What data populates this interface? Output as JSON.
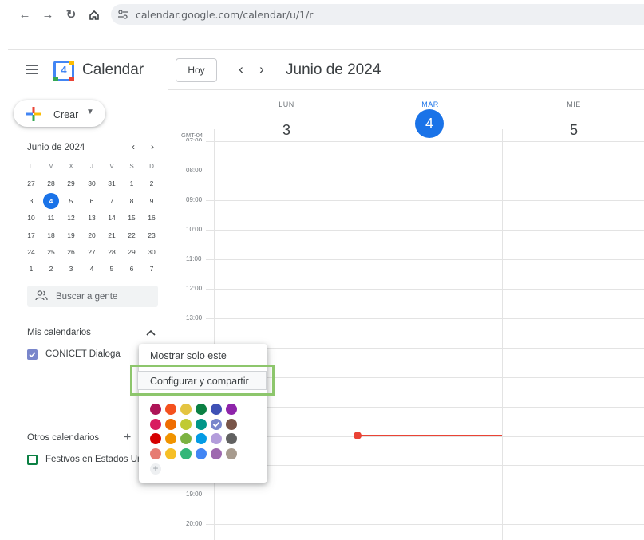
{
  "browser": {
    "url": "calendar.google.com/calendar/u/1/r"
  },
  "header": {
    "app_title": "Calendar",
    "logo_number": "4",
    "today_button": "Hoy",
    "month_title": "Junio de 2024"
  },
  "sidebar": {
    "create_label": "Crear",
    "mini_calendar": {
      "title": "Junio de 2024",
      "weekdays": [
        "L",
        "M",
        "X",
        "J",
        "V",
        "S",
        "D"
      ],
      "weeks": [
        [
          "27",
          "28",
          "29",
          "30",
          "31",
          "1",
          "2"
        ],
        [
          "3",
          "4",
          "5",
          "6",
          "7",
          "8",
          "9"
        ],
        [
          "10",
          "11",
          "12",
          "13",
          "14",
          "15",
          "16"
        ],
        [
          "17",
          "18",
          "19",
          "20",
          "21",
          "22",
          "23"
        ],
        [
          "24",
          "25",
          "26",
          "27",
          "28",
          "29",
          "30"
        ],
        [
          "1",
          "2",
          "3",
          "4",
          "5",
          "6",
          "7"
        ]
      ],
      "today": "4"
    },
    "search_people": "Buscar a gente",
    "my_calendars_title": "Mis calendarios",
    "my_calendars": [
      {
        "name": "CONICET Dialoga",
        "color": "#7986cb",
        "checked": true
      }
    ],
    "other_calendars_title": "Otros calendarios",
    "other_calendars": [
      {
        "name": "Festivos en Estados Un",
        "color": "#0b8043",
        "checked": false
      }
    ]
  },
  "grid": {
    "timezone": "GMT-04",
    "days": [
      {
        "name": "LUN",
        "number": "3",
        "today": false
      },
      {
        "name": "MAR",
        "number": "4",
        "today": true
      },
      {
        "name": "MIÉ",
        "number": "5",
        "today": false
      }
    ],
    "hours": [
      "08:00",
      "09:00",
      "10:00",
      "11:00",
      "12:00",
      "13:00",
      "19:00",
      "20:00"
    ],
    "partial_hour": "07:00"
  },
  "context_menu": {
    "items": [
      "Mostrar solo este",
      "Configurar y compartir"
    ],
    "highlighted_item": "Configurar y compartir",
    "colors": [
      [
        "#ad1457",
        "#f4511e",
        "#e4c441",
        "#0b8043",
        "#3f51b5",
        "#8e24aa"
      ],
      [
        "#d81b60",
        "#ef6c00",
        "#c0ca33",
        "#009688",
        "#7986cb",
        "#795548"
      ],
      [
        "#d50000",
        "#f09300",
        "#7cb342",
        "#039be5",
        "#b39ddb",
        "#616161"
      ],
      [
        "#e67c73",
        "#f6bf26",
        "#33b679",
        "#4285f4",
        "#9e69af",
        "#a79b8e"
      ]
    ],
    "selected_color": "#7986cb",
    "highlight_border_color": "#8dc66c"
  },
  "colors": {
    "accent": "#1a73e8",
    "now_line": "#ea4335"
  }
}
